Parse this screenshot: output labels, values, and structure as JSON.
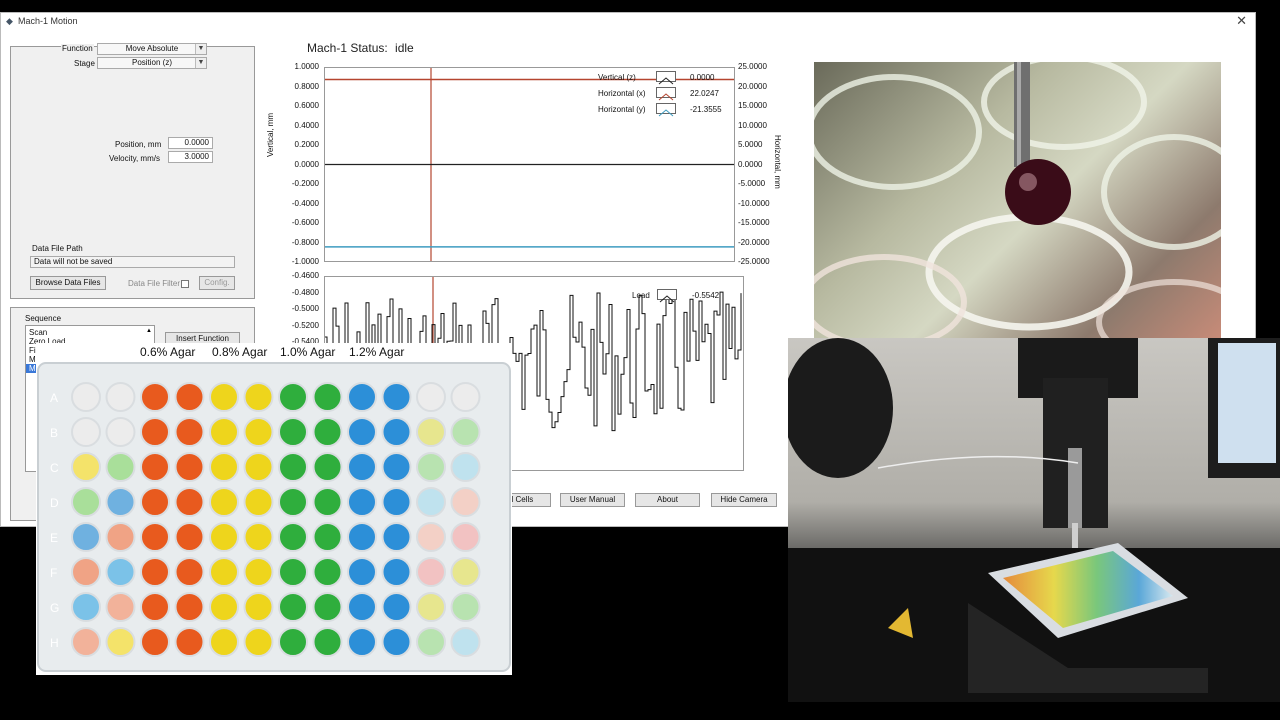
{
  "window": {
    "title": "Mach-1 Motion",
    "close": "✕",
    "icon": "app-icon"
  },
  "controls": {
    "function_label": "Function",
    "function_value": "Move Absolute",
    "stage_label": "Stage",
    "stage_value": "Position (z)",
    "position_label": "Position, mm",
    "position_value": "0.0000",
    "velocity_label": "Velocity, mm/s",
    "velocity_value": "3.0000",
    "datafile_label": "Data File Path",
    "datafile_value": "Data will not be saved",
    "browse_label": "Browse Data Files",
    "filter_label": "Data File Filter",
    "config_label": "Config."
  },
  "sequence": {
    "label": "Sequence",
    "items": [
      "Scan",
      "Zero Load",
      "Fi",
      "M",
      "M"
    ],
    "insert_label": "Insert Function"
  },
  "status": {
    "label": "Mach-1 Status:",
    "value": "idle"
  },
  "main_plot": {
    "ylabel_left": "Vertical, mm",
    "ylabel_right": "Horizontal, mm",
    "left_ticks": [
      "1.0000",
      "0.8000",
      "0.6000",
      "0.4000",
      "0.2000",
      "0.0000",
      "-0.2000",
      "-0.4000",
      "-0.6000",
      "-0.8000",
      "-1.0000"
    ],
    "right_ticks": [
      "25.0000",
      "20.0000",
      "15.0000",
      "10.0000",
      "5.0000",
      "0.0000",
      "-5.0000",
      "-10.0000",
      "-15.0000",
      "-20.0000",
      "-25.0000"
    ],
    "left_range": [
      -1,
      1
    ],
    "right_range": [
      -25,
      25
    ],
    "series": [
      {
        "name": "Vertical (z)",
        "value": "0.0000",
        "color": "#222222"
      },
      {
        "name": "Horizontal (x)",
        "value": "22.0247",
        "color": "#b5452f"
      },
      {
        "name": "Horizontal (y)",
        "value": "-21.3555",
        "color": "#3d9bc0"
      }
    ]
  },
  "load_plot": {
    "ticks": [
      "-0.4600",
      "-0.4800",
      "-0.5000",
      "-0.5200",
      "-0.5400"
    ],
    "legend_name": "Load",
    "legend_value": "-0.5542"
  },
  "buttons": {
    "cells": "d Cells",
    "manual": "User Manual",
    "about": "About",
    "camera": "Hide Camera"
  },
  "plate": {
    "agar_labels": [
      "0.6% Agar",
      "0.8% Agar",
      "1.0% Agar",
      "1.2% Agar"
    ],
    "row_letters": [
      "A",
      "B",
      "C",
      "D",
      "E",
      "F",
      "G",
      "H"
    ]
  }
}
